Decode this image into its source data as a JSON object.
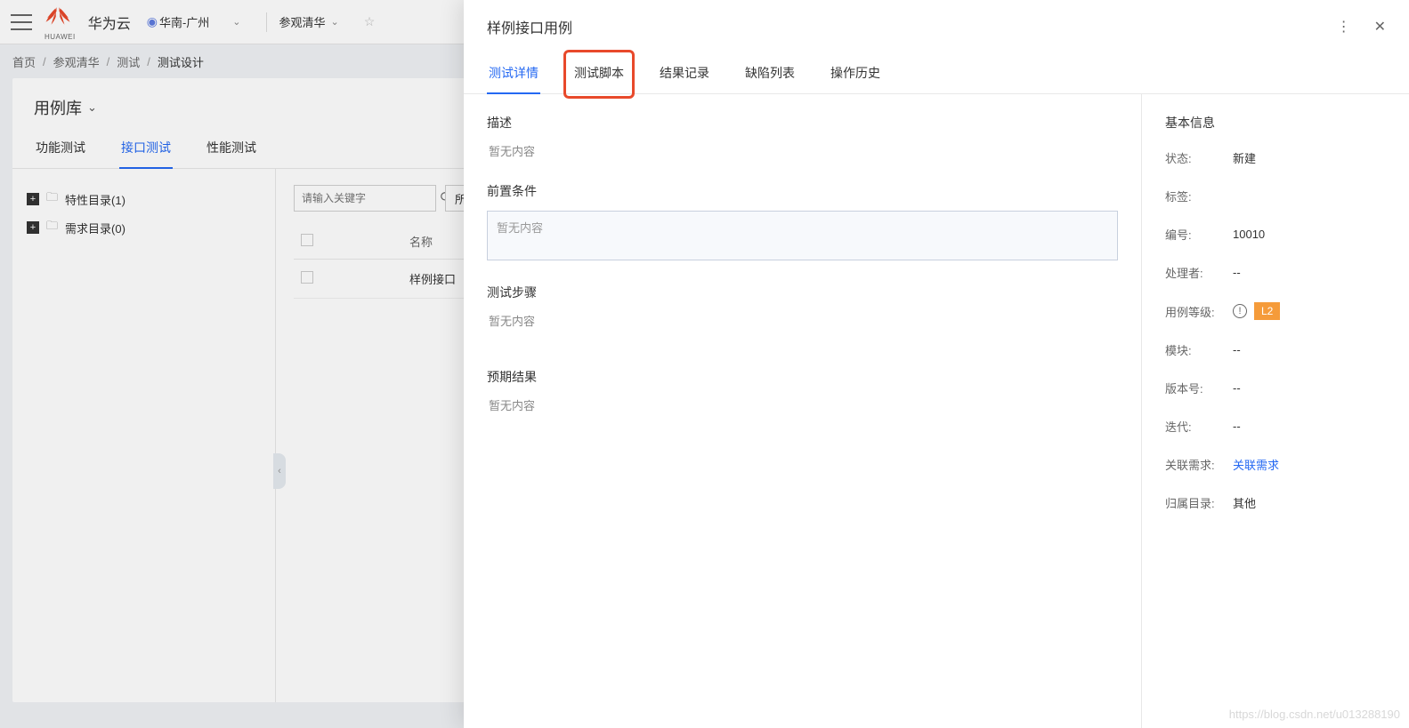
{
  "topbar": {
    "brand": "华为云",
    "logo_sub": "HUAWEI",
    "region": "华南-广州",
    "project": "参观清华"
  },
  "breadcrumb": {
    "items": [
      "首页",
      "参观清华",
      "测试",
      "测试设计"
    ]
  },
  "library": {
    "title": "用例库",
    "tabs": [
      "功能测试",
      "接口测试",
      "性能测试"
    ],
    "active_tab_index": 1
  },
  "tree": {
    "items": [
      {
        "label": "特性目录(1)"
      },
      {
        "label": "需求目录(0)"
      }
    ]
  },
  "list": {
    "search_placeholder": "请输入关键字",
    "filter_label": "所有",
    "columns": {
      "name": "名称"
    },
    "rows": [
      {
        "name": "样例接口"
      }
    ]
  },
  "panel": {
    "title": "样例接口用例",
    "tabs": [
      "测试详情",
      "测试脚本",
      "结果记录",
      "缺陷列表",
      "操作历史"
    ],
    "active_tab_index": 0,
    "highlight_tab_index": 1,
    "sections": {
      "desc_label": "描述",
      "desc_empty": "暂无内容",
      "precond_label": "前置条件",
      "precond_placeholder": "暂无内容",
      "steps_label": "测试步骤",
      "steps_empty": "暂无内容",
      "expected_label": "预期结果",
      "expected_empty": "暂无内容"
    },
    "side": {
      "title": "基本信息",
      "rows": {
        "status_l": "状态:",
        "status_v": "新建",
        "tags_l": "标签:",
        "tags_v": "",
        "id_l": "编号:",
        "id_v": "10010",
        "handler_l": "处理者:",
        "handler_v": "--",
        "level_l": "用例等级:",
        "level_v": "L2",
        "module_l": "模块:",
        "module_v": "--",
        "version_l": "版本号:",
        "version_v": "--",
        "iter_l": "迭代:",
        "iter_v": "--",
        "rel_l": "关联需求:",
        "rel_v": "关联需求",
        "dir_l": "归属目录:",
        "dir_v": "其他"
      }
    }
  },
  "watermark": "https://blog.csdn.net/u013288190"
}
